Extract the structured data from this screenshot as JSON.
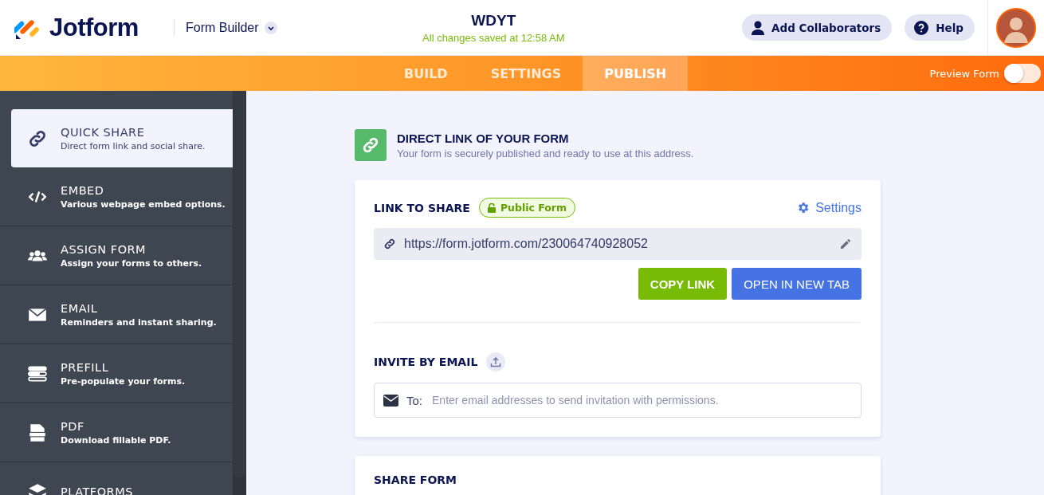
{
  "header": {
    "brand": "Jotform",
    "app_switcher": "Form Builder",
    "form_title": "WDYT",
    "save_status": "All changes saved at 12:58 AM",
    "buttons": [
      {
        "kind": "collaborators",
        "label": "Add Collaborators"
      },
      {
        "kind": "help",
        "label": "Help"
      }
    ]
  },
  "tabs": [
    {
      "label": "BUILD",
      "selected": false
    },
    {
      "label": "SETTINGS",
      "selected": false
    },
    {
      "label": "PUBLISH",
      "selected": true
    }
  ],
  "preview_form": {
    "label": "Preview Form",
    "on": false
  },
  "sidebar": {
    "items": [
      {
        "kind": "link",
        "title": "QUICK SHARE",
        "subtitle": "Direct form link and social share.",
        "selected": true
      },
      {
        "kind": "code",
        "title": "EMBED",
        "subtitle": "Various webpage embed options.",
        "selected": false
      },
      {
        "kind": "users",
        "title": "ASSIGN FORM",
        "subtitle": "Assign your forms to others.",
        "selected": false
      },
      {
        "kind": "mail",
        "title": "EMAIL",
        "subtitle": "Reminders and instant sharing.",
        "selected": false
      },
      {
        "kind": "prefill",
        "title": "PREFILL",
        "subtitle": "Pre-populate your forms.",
        "selected": false
      },
      {
        "kind": "pdf",
        "title": "PDF",
        "subtitle": "Download fillable PDF.",
        "selected": false
      },
      {
        "kind": "layers",
        "title": "PLATFORMS",
        "selected": false
      }
    ]
  },
  "intro": {
    "title": "DIRECT LINK OF YOUR FORM",
    "subtitle": "Your form is securely published and ready to use at this address."
  },
  "link_card": {
    "heading": "LINK TO SHARE",
    "badge": "Public Form",
    "settings_link": "Settings",
    "url": "https://form.jotform.com/230064740928052",
    "buttons": [
      {
        "kind": "copy",
        "label": "COPY LINK"
      },
      {
        "kind": "open",
        "label": "OPEN IN NEW TAB"
      }
    ],
    "invite_heading": "INVITE BY EMAIL",
    "to_label": "To:",
    "email_placeholder": "Enter email addresses to send invitation with permissions."
  },
  "share_card": {
    "heading": "SHARE FORM"
  }
}
